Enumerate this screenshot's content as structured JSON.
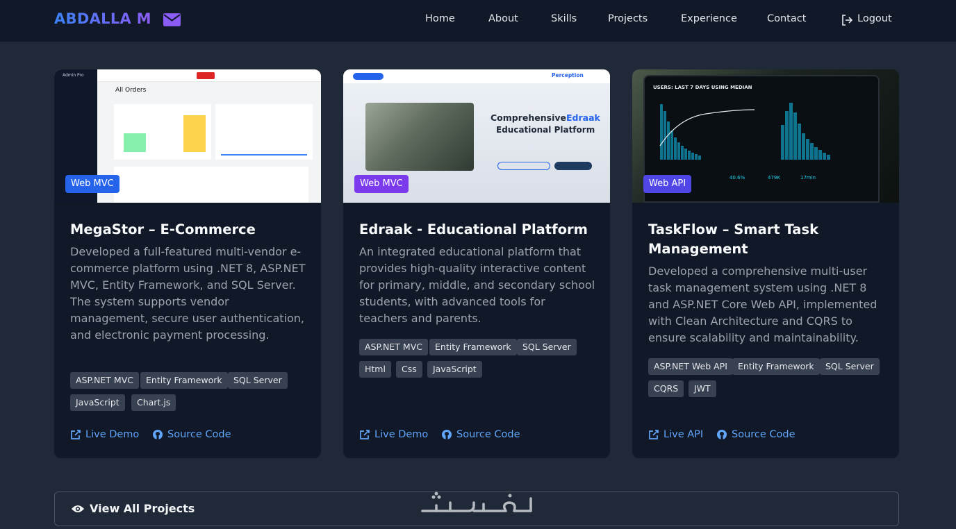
{
  "navbar": {
    "brand": "ABDALLA M",
    "links": [
      "Home",
      "About",
      "Skills",
      "Projects",
      "Experience",
      "Contact"
    ],
    "logout": "Logout"
  },
  "projects": [
    {
      "badge": "Web MVC",
      "badge_color": "#2563eb",
      "title": "MegaStor – E-Commerce",
      "description": "Developed a full-featured multi-vendor e-commerce platform using .NET 8, ASP.NET MVC, Entity Framework, and SQL Server. The system supports vendor management, secure user authentication, and electronic payment processing.",
      "tags": [
        "ASP.NET MVC",
        "Entity Framework",
        "SQL Server",
        "JavaScript",
        "Chart.js"
      ],
      "link1": "Live Demo",
      "link2": "Source Code",
      "thumb": {
        "sidebar_brand": "Admin Pro",
        "page_title": "All Orders"
      }
    },
    {
      "badge": "Web MVC",
      "badge_color": "#7c3aed",
      "title": "Edraak - Educational Platform",
      "description": "An integrated educational platform that provides high-quality interactive content for primary, middle, and secondary school students, with advanced tools for teachers and parents.",
      "tags": [
        "ASP.NET MVC",
        "Entity Framework",
        "SQL Server",
        "Html",
        "Css",
        "JavaScript"
      ],
      "link1": "Live Demo",
      "link2": "Source Code",
      "thumb": {
        "heading_a": "Comprehensive",
        "heading_b": "Edraak",
        "heading_c": "Educational Platform",
        "logo": "Perception"
      }
    },
    {
      "badge": "Web API",
      "badge_color": "#4f46e5",
      "title": "TaskFlow – Smart Task Management",
      "description": "Developed a comprehensive multi-user task management system using .NET 8 and ASP.NET Core Web API, implemented with Clean Architecture and CQRS to ensure scalability and maintainability.",
      "tags": [
        "ASP.NET Web API",
        "Entity Framework",
        "SQL Server",
        "CQRS",
        "JWT"
      ],
      "link1": "Live API",
      "link2": "Source Code",
      "thumb": {
        "header": "USERS: LAST 7 DAYS USING MEDIAN",
        "stat1": "479K",
        "stat2": "17min",
        "stat3": "40.6%"
      }
    }
  ],
  "view_all": {
    "label": "View All Projects"
  },
  "watermark": "خمسات",
  "colors": {
    "accent": "#60a5fa",
    "bg": "#1f2937",
    "card": "#111827",
    "tag": "#374151"
  }
}
